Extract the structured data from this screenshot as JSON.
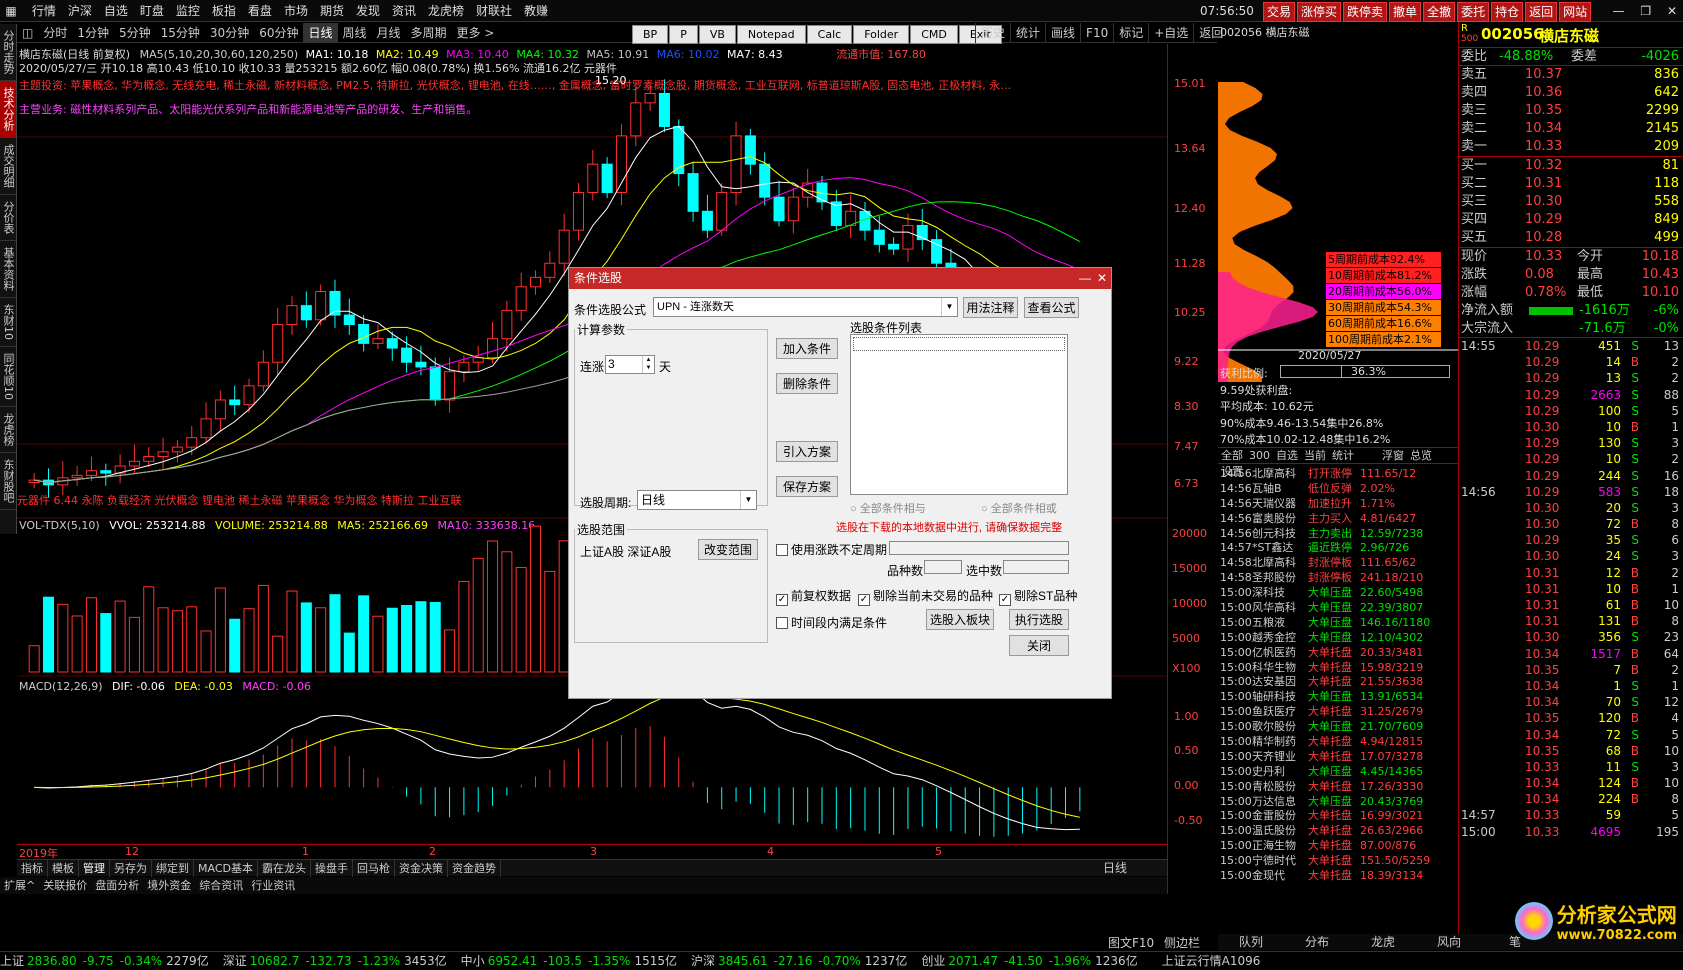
{
  "menu": [
    "行情",
    "沪深",
    "自选",
    "盯盘",
    "监控",
    "板指",
    "看盘",
    "市场",
    "期货",
    "发现",
    "资讯",
    "龙虎榜",
    "财联社",
    "教赚"
  ],
  "top_right": {
    "time": "07:56:50",
    "weekday": "周四"
  },
  "red_tabs": [
    "交易",
    "涨停买",
    "跌停卖",
    "撤单",
    "全撤",
    "委托",
    "持仓",
    "返回",
    "网站"
  ],
  "left_tabs": [
    "分时走势",
    "技术分析",
    "成交明细",
    "分价表",
    "基本资料",
    "东财10",
    "同花顺10",
    "龙虎榜",
    "东财股吧"
  ],
  "periods": [
    "分时",
    "1分钟",
    "5分钟",
    "15分钟",
    "30分钟",
    "60分钟",
    "日线",
    "周线",
    "月线",
    "多周期",
    "更多 >"
  ],
  "tool_buttons": [
    "BP",
    "P",
    "VB",
    "Notepad",
    "Calc",
    "Folder",
    "CMD",
    "Exit"
  ],
  "right_tools": [
    "历史",
    "统计",
    "画线",
    "F10",
    "标记",
    "+自选",
    "返回"
  ],
  "chart_header": {
    "stock_line": "横店东磁(日线 前复权)",
    "ma_label": "MA5(5,10,20,30,60,120,250)",
    "ma1": "MA1: 10.18",
    "ma2": "MA2: 10.49",
    "ma3": "MA3: 10.40",
    "ma4": "MA4: 10.32",
    "ma5": "MA5: 10.91",
    "ma6": "MA6: 10.02",
    "ma7": "MA7: 8.43",
    "float_mv": "流通市值: 167.80",
    "date_line": "2020/05/27/三 开10.18 高10.43 低10.10 收10.33 量253215 额2.60亿 幅0.08(0.78%) 换1.56% 流通16.2亿 元器件",
    "concepts": "主题投资: 苹果概念, 华为概念, 无线充电, 稀土永磁, 新材料概念, PM2.5, 特斯拉, 光伏概念, 锂电池, 在线……, 金属概念, 富时罗素概念股, 期货概念, 工业互联网, 标普道琼斯A股, 固态电池, 正极材料, 永…",
    "business": "主营业务: 磁性材料系列产品、太阳能光伏系列产品和新能源电池等产品的研发、生产和销售。",
    "bottom_concepts": "元器件 6.44 永陈 负载经济 光伏概念 锂电池 稀土永磁 苹果概念 华为概念 特斯拉 工业互联",
    "peak_label": "15.20"
  },
  "price_axis": [
    "15.01",
    "13.64",
    "12.40",
    "11.28",
    "10.25",
    "9.22",
    "8.30",
    "7.47",
    "6.73"
  ],
  "volume_header": {
    "label": "VOL-TDX(5,10)",
    "vvol": "VVOL: 253214.88",
    "volume": "VOLUME: 253214.88",
    "ma5": "MA5: 252166.69",
    "ma10": "MA10: 333638.16"
  },
  "volume_axis": [
    "20000",
    "15000",
    "10000",
    "5000",
    "X100"
  ],
  "macd_header": {
    "label": "MACD(12,26,9)",
    "dif": "DIF: -0.06",
    "dea": "DEA: -0.03",
    "macd": "MACD: -0.06"
  },
  "macd_axis": [
    "1.00",
    "0.50",
    "0.00",
    "-0.50"
  ],
  "time_axis": [
    "2019年",
    "12",
    "1",
    "2",
    "3",
    "4",
    "5"
  ],
  "bottom_tabs": [
    "指标",
    "模板",
    "管理",
    "另存为",
    "绑定到",
    "MACD基本",
    "霸在龙头",
    "操盘手",
    "回马枪",
    "资金决策",
    "资金趋势"
  ],
  "bottom_tabs2": [
    "扩展^",
    "关联报价",
    "盘面分析",
    "境外资金",
    "综合资讯",
    "行业资讯"
  ],
  "period_label": "日线",
  "ticker_bar": [
    {
      "name": "上证",
      "val": "2836.80",
      "chg": "-9.75",
      "pct": "-0.34%",
      "amt": "2279亿"
    },
    {
      "name": "深证",
      "val": "10682.7",
      "chg": "-132.73",
      "pct": "-1.23%",
      "amt": "3453亿"
    },
    {
      "name": "中小",
      "val": "6952.41",
      "chg": "-103.5",
      "pct": "-1.35%",
      "amt": "1515亿"
    },
    {
      "name": "沪深",
      "val": "3845.61",
      "chg": "-27.16",
      "pct": "-0.70%",
      "amt": "1237亿"
    },
    {
      "name": "创业",
      "val": "2071.47",
      "chg": "-41.50",
      "pct": "-1.96%",
      "amt": "1236亿"
    }
  ],
  "ticker_right": "上证云行情A1096",
  "cost_panel": {
    "code": "002056 横店东磁",
    "labels": [
      "5周期前成本92.4%",
      "10周期前成本81.2%",
      "20周期前成本56.0%",
      "30周期前成本54.3%",
      "60周期前成本16.6%",
      "100周期前成本2.1%"
    ],
    "label_colors": [
      "#ff2020",
      "#ff2020",
      "#ff00ff",
      "#ff8000",
      "#ff8000",
      "#ff8000"
    ],
    "date": "2020/05/27",
    "profit_ratio_label": "获利比例:",
    "profit_ratio": "36.3%",
    "profit_at": "9.59处获利盘:",
    "avg_cost": "平均成本: 10.62元",
    "cost90": "90%成本9.46-13.54集中26.8%",
    "cost70": "70%成本10.02-12.48集中16.2%"
  },
  "alert_tabs": [
    "全部",
    "300",
    "自选",
    "当前",
    "统计",
    "浮窗",
    "总览",
    "设置"
  ],
  "alerts": [
    [
      "14:56",
      "北摩高科",
      "打开涨停",
      "111.65/12"
    ],
    [
      "14:56",
      "瓦轴B",
      "低位反弹",
      "2.02%"
    ],
    [
      "14:56",
      "天瑞仪器",
      "加速拉升",
      "1.71%"
    ],
    [
      "14:56",
      "富奥股份",
      "主力买入",
      "4.81/6427"
    ],
    [
      "14:56",
      "创元科技",
      "主力卖出",
      "12.59/7238"
    ],
    [
      "14:57",
      "*ST鑫达",
      "逼近跌停",
      "2.96/726"
    ],
    [
      "14:58",
      "北摩高科",
      "封涨停板",
      "111.65/62"
    ],
    [
      "14:58",
      "圣邦股份",
      "封涨停板",
      "241.18/210"
    ],
    [
      "15:00",
      "深科技",
      "大单压盘",
      "22.60/5498"
    ],
    [
      "15:00",
      "风华高科",
      "大单压盘",
      "22.39/3807"
    ],
    [
      "15:00",
      "五粮液",
      "大单压盘",
      "146.16/1180"
    ],
    [
      "15:00",
      "越秀金控",
      "大单压盘",
      "12.10/4302"
    ],
    [
      "15:00",
      "亿帆医药",
      "大单托盘",
      "20.33/3481"
    ],
    [
      "15:00",
      "科华生物",
      "大单托盘",
      "15.98/3219"
    ],
    [
      "15:00",
      "达安基因",
      "大单托盘",
      "21.55/3638"
    ],
    [
      "15:00",
      "轴研科技",
      "大单压盘",
      "13.91/6534"
    ],
    [
      "15:00",
      "鱼跃医疗",
      "大单托盘",
      "31.25/2679"
    ],
    [
      "15:00",
      "歌尔股份",
      "大单压盘",
      "21.70/7609"
    ],
    [
      "15:00",
      "精华制药",
      "大单托盘",
      "4.94/12815"
    ],
    [
      "15:00",
      "天齐锂业",
      "大单托盘",
      "17.07/3278"
    ],
    [
      "15:00",
      "史丹利",
      "大单压盘",
      "4.45/14365"
    ],
    [
      "15:00",
      "青松股份",
      "大单托盘",
      "17.26/3330"
    ],
    [
      "15:00",
      "万达信息",
      "大单压盘",
      "20.43/3769"
    ],
    [
      "15:00",
      "金雷股份",
      "大单托盘",
      "16.99/3021"
    ],
    [
      "15:00",
      "温氏股份",
      "大单托盘",
      "26.63/2966"
    ],
    [
      "15:00",
      "正海生物",
      "大单托盘",
      "87.00/876"
    ],
    [
      "15:00",
      "宁德时代",
      "大单托盘",
      "151.50/5259"
    ],
    [
      "15:00",
      "金现代",
      "大单托盘",
      "18.39/3134"
    ]
  ],
  "bottom_right_tabs": [
    "队列",
    "分布",
    "龙虎",
    "风向",
    "笔"
  ],
  "bottom_mid": [
    "图文F10",
    "侧边栏"
  ],
  "quote": {
    "r_mark": "R",
    "r_num": "500",
    "code": "002056",
    "name": "横店东磁",
    "wb_label": "委比",
    "wb": "-48.88%",
    "wc_label": "委差",
    "wc": "-4026",
    "asks": [
      [
        "卖五",
        "10.37",
        "836"
      ],
      [
        "卖四",
        "10.36",
        "642"
      ],
      [
        "卖三",
        "10.35",
        "2299"
      ],
      [
        "卖二",
        "10.34",
        "2145"
      ],
      [
        "卖一",
        "10.33",
        "209"
      ]
    ],
    "bids": [
      [
        "买一",
        "10.32",
        "81"
      ],
      [
        "买二",
        "10.31",
        "118"
      ],
      [
        "买三",
        "10.30",
        "558"
      ],
      [
        "买四",
        "10.29",
        "849"
      ],
      [
        "买五",
        "10.28",
        "499"
      ]
    ],
    "stats": [
      [
        "现价",
        "10.33",
        "今开",
        "10.18"
      ],
      [
        "涨跌",
        "0.08",
        "最高",
        "10.43"
      ],
      [
        "涨幅",
        "0.78%",
        "最低",
        "10.10"
      ]
    ],
    "netin_label": "净流入额",
    "netin": "-1616万",
    "netin_pct": "-6%",
    "bulk_label": "大宗流入",
    "bulk": "-71.6万",
    "bulk_pct": "-0%",
    "ticks": [
      [
        "14:55",
        "10.29",
        "451",
        "S",
        "13"
      ],
      [
        "",
        "10.29",
        "14",
        "B",
        "2"
      ],
      [
        "",
        "10.29",
        "13",
        "S",
        "2"
      ],
      [
        "",
        "10.29",
        "2663",
        "S",
        "88"
      ],
      [
        "",
        "10.29",
        "100",
        "S",
        "5"
      ],
      [
        "",
        "10.30",
        "10",
        "B",
        "1"
      ],
      [
        "",
        "10.29",
        "130",
        "S",
        "3"
      ],
      [
        "",
        "10.29",
        "10",
        "S",
        "2"
      ],
      [
        "",
        "10.29",
        "244",
        "S",
        "16"
      ],
      [
        "14:56",
        "10.29",
        "583",
        "S",
        "18"
      ],
      [
        "",
        "10.30",
        "20",
        "S",
        "3"
      ],
      [
        "",
        "10.30",
        "72",
        "B",
        "8"
      ],
      [
        "",
        "10.29",
        "35",
        "S",
        "6"
      ],
      [
        "",
        "10.30",
        "24",
        "S",
        "3"
      ],
      [
        "",
        "10.31",
        "12",
        "B",
        "2"
      ],
      [
        "",
        "10.31",
        "10",
        "B",
        "1"
      ],
      [
        "",
        "10.31",
        "61",
        "B",
        "10"
      ],
      [
        "",
        "10.31",
        "131",
        "B",
        "8"
      ],
      [
        "",
        "10.30",
        "356",
        "S",
        "23"
      ],
      [
        "",
        "10.34",
        "1517",
        "B",
        "64"
      ],
      [
        "",
        "10.35",
        "7",
        "B",
        "2"
      ],
      [
        "",
        "10.34",
        "1",
        "S",
        "1"
      ],
      [
        "",
        "10.34",
        "70",
        "S",
        "12"
      ],
      [
        "",
        "10.35",
        "120",
        "B",
        "4"
      ],
      [
        "",
        "10.34",
        "72",
        "S",
        "5"
      ],
      [
        "",
        "10.35",
        "68",
        "B",
        "10"
      ],
      [
        "",
        "10.33",
        "11",
        "S",
        "3"
      ],
      [
        "",
        "10.34",
        "124",
        "B",
        "10"
      ],
      [
        "",
        "10.34",
        "224",
        "B",
        "8"
      ],
      [
        "14:57",
        "10.33",
        "59",
        "",
        "5"
      ],
      [
        "15:00",
        "10.33",
        "4695",
        "",
        "195"
      ]
    ]
  },
  "dialog": {
    "title": "条件选股",
    "formula_label": "条件选股公式",
    "formula_value": "UPN - 连涨数天",
    "usage_btn": "用法注释",
    "view_btn": "查看公式",
    "params_legend": "计算参数",
    "param_label": "连涨",
    "param_value": "3",
    "param_unit": "天",
    "cycle_label": "选股周期:",
    "cycle_value": "日线",
    "range_legend": "选股范围",
    "range_value": "上证A股 深证A股",
    "change_range_btn": "改变范围",
    "add_btn": "加入条件",
    "del_btn": "删除条件",
    "import_btn": "引入方案",
    "save_btn": "保存方案",
    "list_label": "选股条件列表",
    "radio_and": "全部条件相与",
    "radio_or": "全部条件相或",
    "warning": "选股在下载的本地数据中进行, 请确保数据完整",
    "cb_uncertain": "使用涨跌不定周期",
    "count_label": "品种数",
    "selected_label": "选中数",
    "cb_fq": "前复权数据",
    "cb_exclude": "剔除当前未交易的品种",
    "cb_st": "剔除ST品种",
    "cb_time": "时间段内满足条件",
    "to_block_btn": "选股入板块",
    "exec_btn": "执行选股",
    "close_btn": "关闭"
  },
  "watermark": {
    "text": "分析家公式网",
    "url": "www.70822.com"
  },
  "chart_data": {
    "type": "candlestick",
    "title": "横店东磁(日线 前复权)",
    "ylim": [
      6.5,
      15.3
    ],
    "peak": 15.2,
    "close_last": 10.33,
    "approx_closes": [
      6.9,
      6.8,
      6.95,
      7.0,
      7.1,
      7.05,
      7.2,
      7.3,
      7.4,
      7.5,
      7.6,
      7.8,
      8.2,
      8.6,
      8.5,
      8.9,
      9.4,
      10.2,
      10.6,
      10.3,
      10.9,
      10.4,
      10.2,
      9.8,
      9.9,
      9.7,
      9.4,
      9.3,
      8.6,
      9.2,
      9.4,
      9.5,
      9.9,
      10.5,
      11.0,
      11.2,
      11.5,
      12.2,
      13.0,
      13.6,
      13.0,
      14.2,
      14.9,
      15.1,
      14.4,
      13.4,
      12.6,
      12.2,
      13.0,
      14.2,
      13.6,
      12.9,
      12.4,
      12.9,
      13.2,
      12.8,
      12.3,
      12.6,
      12.2,
      11.9,
      11.8,
      12.3,
      12.0,
      11.5,
      11.2,
      10.9,
      10.6,
      10.4,
      10.3,
      10.2,
      10.1,
      10.3,
      10.25,
      10.33
    ],
    "volume_ylim": [
      0,
      21000
    ],
    "macd_ylim": [
      -0.6,
      1.2
    ]
  }
}
